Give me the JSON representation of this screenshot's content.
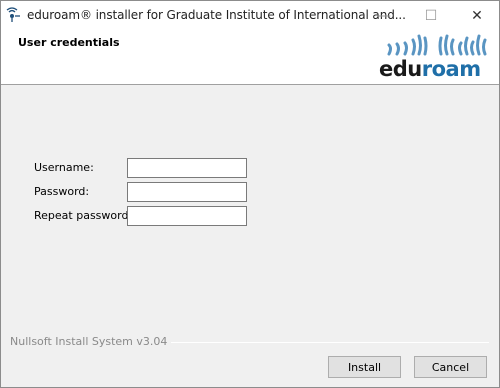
{
  "window": {
    "title": "eduroam® installer for Graduate Institute of International and...",
    "controls": {
      "minimize": "—",
      "maximize": "☐",
      "close": "✕"
    }
  },
  "header": {
    "title": "User credentials",
    "logo_text": "eduroam",
    "logo_colors": {
      "edu": "#1a1a1a",
      "roam": "#1f6fa8",
      "waves": "#5a95c2"
    }
  },
  "form": {
    "username_label": "Username:",
    "password_label": "Password:",
    "repeat_password_label": "Repeat password:",
    "username_value": "",
    "password_value": "",
    "repeat_password_value": ""
  },
  "footer": {
    "brand_text": "Nullsoft Install System v3.04",
    "install_label": "Install",
    "cancel_label": "Cancel"
  }
}
